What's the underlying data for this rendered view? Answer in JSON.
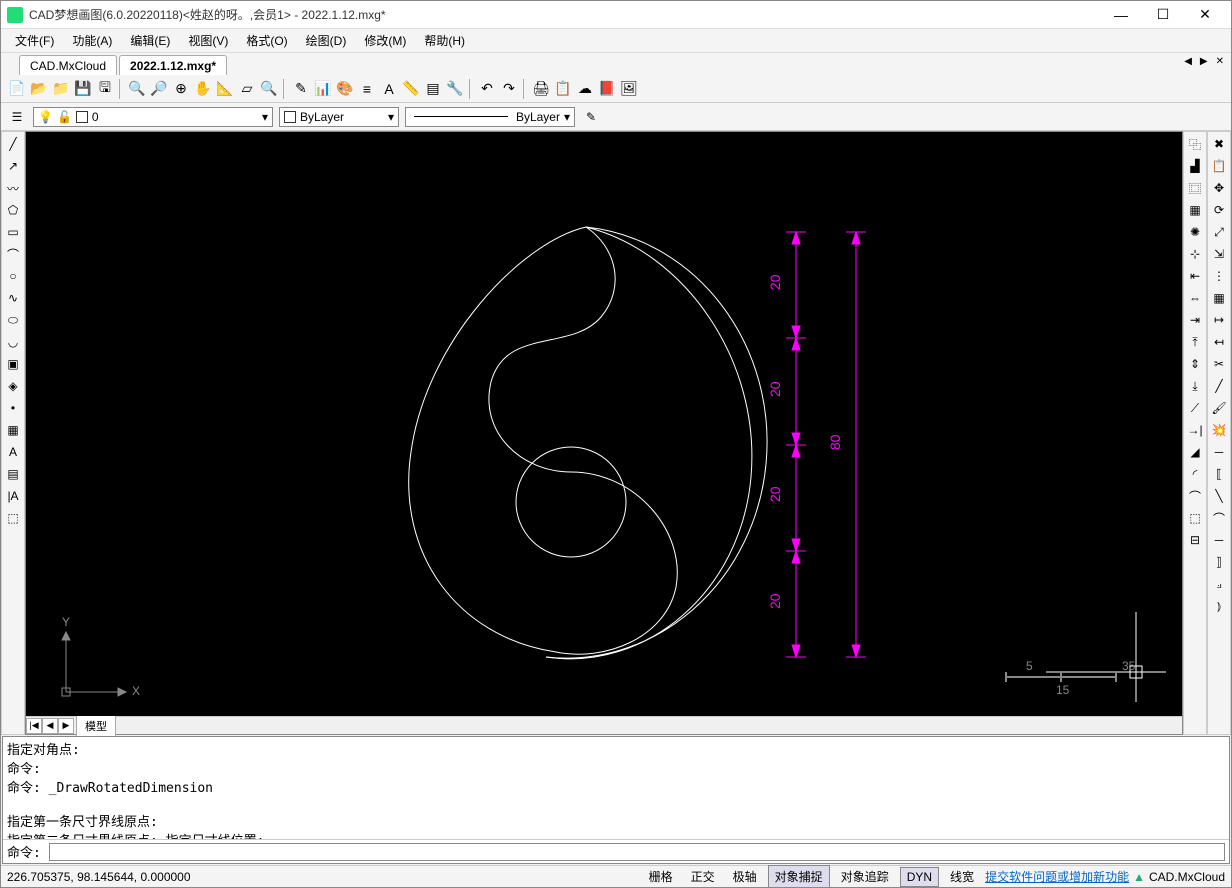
{
  "window": {
    "title": "CAD梦想画图(6.0.20220118)<姓赵的呀。,会员1> - 2022.1.12.mxg*",
    "min": "—",
    "max": "☐",
    "close": "✕"
  },
  "menu": [
    "文件(F)",
    "功能(A)",
    "编辑(E)",
    "视图(V)",
    "格式(O)",
    "绘图(D)",
    "修改(M)",
    "帮助(H)"
  ],
  "tabs": [
    {
      "label": "CAD.MxCloud",
      "active": false
    },
    {
      "label": "2022.1.12.mxg*",
      "active": true
    }
  ],
  "layer": {
    "current": "0",
    "color": "ByLayer",
    "linetype": "ByLayer"
  },
  "commands": {
    "history": "指定对角点:\n命令:\n命令: _DrawRotatedDimension\n\n指定第一条尺寸界线原点:\n指定第二条尺寸界线原点: 指定尺寸线位置:",
    "prompt": "命令:",
    "input": ""
  },
  "status": {
    "coords": "226.705375,  98.145644,  0.000000",
    "buttons": [
      "栅格",
      "正交",
      "极轴",
      "对象捕捉",
      "对象追踪",
      "DYN",
      "线宽"
    ],
    "active_idx": [
      3,
      5
    ],
    "link": "提交软件问题或增加新功能",
    "brand": "CAD.MxCloud"
  },
  "model_tab": "模型",
  "dimensions": {
    "d1": "20",
    "d2": "20",
    "d3": "20",
    "d4": "20",
    "overall": "80"
  },
  "ucs": {
    "x": "X",
    "y": "Y"
  },
  "ruler": {
    "l": "5",
    "r": "35",
    "b": "15"
  }
}
